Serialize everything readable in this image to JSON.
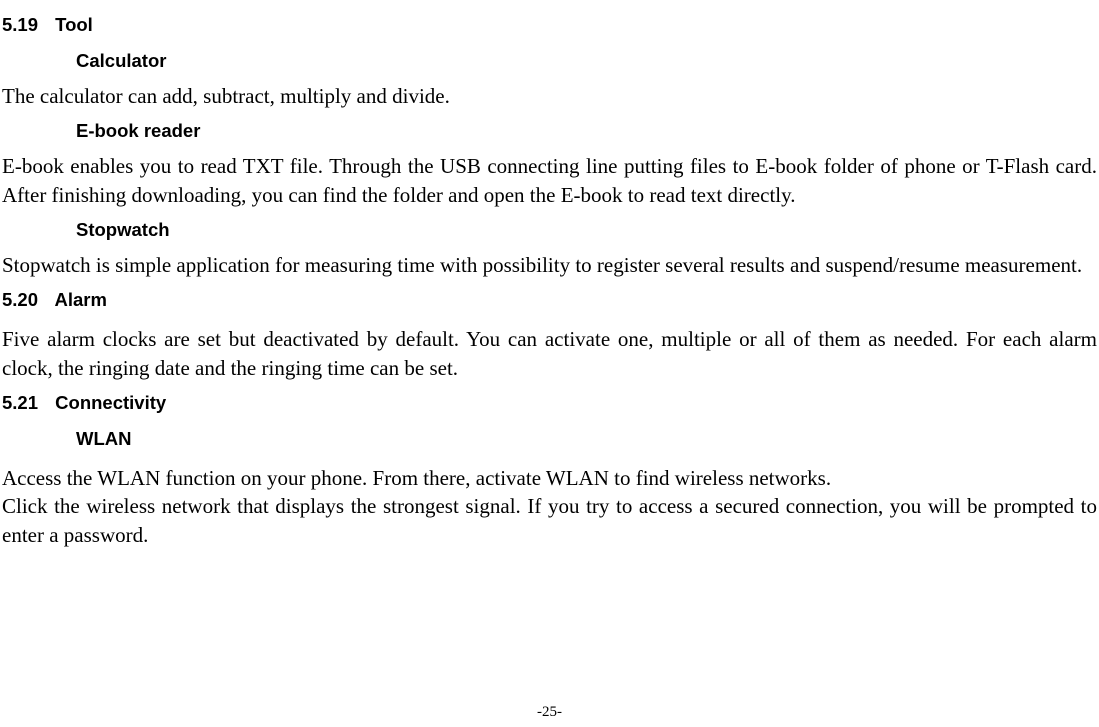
{
  "section_5_19": {
    "num": "5.19",
    "title": "Tool",
    "calculator": {
      "heading": "Calculator",
      "text": "The calculator can add, subtract, multiply and divide."
    },
    "ebook": {
      "heading": "E-book reader",
      "text": "E-book enables you to read TXT file. Through the USB connecting line putting files to E-book folder of phone or T-Flash card. After finishing downloading, you can find the folder and open the E-book to read text directly."
    },
    "stopwatch": {
      "heading": "Stopwatch",
      "text": "Stopwatch is simple application for measuring time with possibility to register several results and suspend/resume measurement."
    }
  },
  "section_5_20": {
    "num": "5.20",
    "title": "Alarm",
    "text": "Five alarm clocks are set but deactivated by default. You can activate one, multiple or all of them as needed. For each alarm clock, the ringing date and the ringing time can be set."
  },
  "section_5_21": {
    "num": "5.21",
    "title": "Connectivity",
    "wlan": {
      "heading": "WLAN",
      "text1": "Access the WLAN function on your phone. From there, activate WLAN to find wireless networks.",
      "text2": "Click the wireless network that displays the strongest signal. If you try to access a secured connection, you will be prompted to enter a password."
    }
  },
  "page_number": "-25-"
}
